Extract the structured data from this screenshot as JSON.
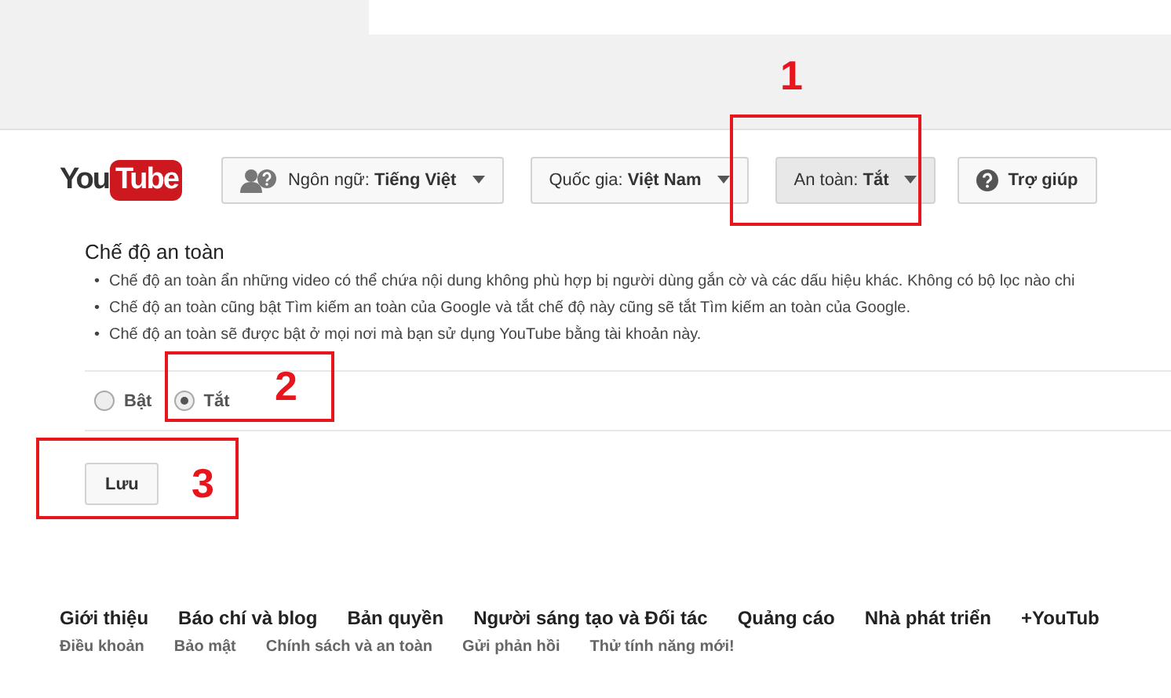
{
  "header": {
    "logo": {
      "you": "You",
      "tube": "Tube"
    },
    "buttons": [
      {
        "kind": "language",
        "label": "Ngôn ngữ:",
        "value": "Tiếng Việt",
        "active": false
      },
      {
        "kind": "plain",
        "label": "Quốc gia:",
        "value": "Việt Nam",
        "active": false
      },
      {
        "kind": "plain",
        "label": "An toàn:",
        "value": "Tắt",
        "active": true
      },
      {
        "kind": "help",
        "label": "Trợ giúp",
        "active": false
      }
    ]
  },
  "safety": {
    "title": "Chế độ an toàn",
    "bullets": [
      "Chế độ an toàn ẩn những video có thể chứa nội dung không phù hợp bị người dùng gắn cờ và các dấu hiệu khác. Không có bộ lọc nào chi",
      "Chế độ an toàn cũng bật Tìm kiếm an toàn của Google và tắt chế độ này cũng sẽ tắt Tìm kiếm an toàn của Google.",
      "Chế độ an toàn sẽ được bật ở mọi nơi mà bạn sử dụng YouTube bằng tài khoản này."
    ],
    "options": [
      {
        "label": "Bật",
        "selected": false
      },
      {
        "label": "Tắt",
        "selected": true
      }
    ],
    "save": "Lưu"
  },
  "footer": {
    "primary": [
      "Giới thiệu",
      "Báo chí và blog",
      "Bản quyền",
      "Người sáng tạo và Đối tác",
      "Quảng cáo",
      "Nhà phát triển",
      "+YouTub"
    ],
    "secondary": [
      "Điều khoản",
      "Bảo mật",
      "Chính sách và an toàn",
      "Gửi phản hồi",
      "Thử tính năng mới!"
    ]
  },
  "bullet_marker": "•",
  "annotations": [
    {
      "number": "1"
    },
    {
      "number": "2"
    },
    {
      "number": "3"
    }
  ]
}
